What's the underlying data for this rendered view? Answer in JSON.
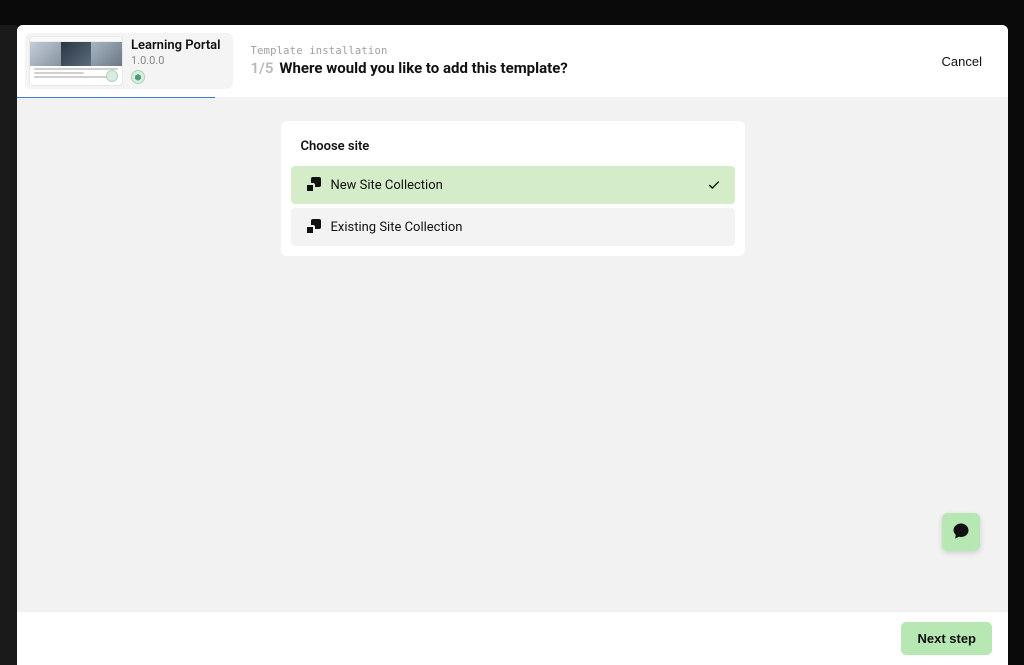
{
  "template": {
    "name": "Learning Portal",
    "version": "1.0.0.0"
  },
  "wizard": {
    "crumb": "Template installation",
    "step_label": "1/5",
    "question": "Where would you like to add this template?",
    "cancel_label": "Cancel"
  },
  "card": {
    "title": "Choose site",
    "options": [
      {
        "label": "New Site Collection",
        "selected": true
      },
      {
        "label": "Existing Site Collection",
        "selected": false
      }
    ]
  },
  "footer": {
    "next_label": "Next step"
  }
}
